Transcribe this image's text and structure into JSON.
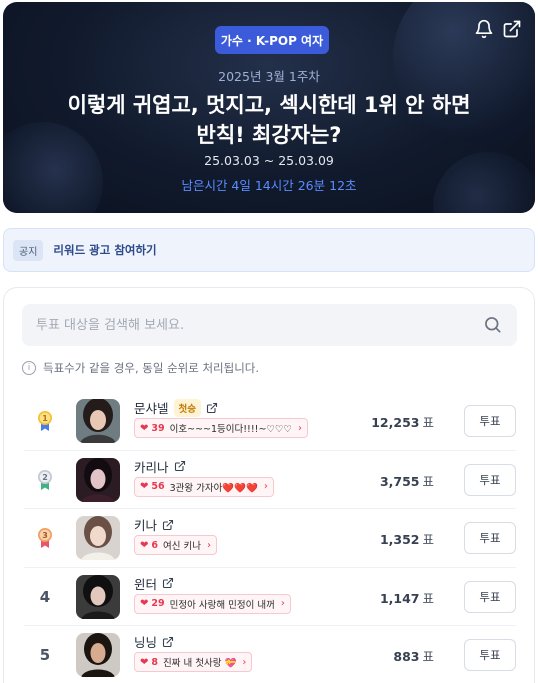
{
  "hero": {
    "category": "가수 · K-POP 여자",
    "week": "2025년 3월 1주차",
    "title_line1": "이렇게 귀엽고, 멋지고, 섹시한데 1위 안 하면",
    "title_line2": "반칙! 최강자는?",
    "dates": "25.03.03 ~ 25.03.09",
    "remaining": "남은시간 4일 14시간 26분 12초",
    "icons": [
      "bell-icon",
      "share-icon"
    ]
  },
  "notice": {
    "tag": "공지",
    "text": "리워드 광고 참여하기"
  },
  "search": {
    "placeholder": "투표 대상을 검색해 보세요."
  },
  "info_text": "득표수가 같을 경우, 동일 순위로 처리됩니다.",
  "colors": {
    "accent": "#3b5bdb",
    "remaining": "#5b8bff",
    "cheer_red": "#e63950",
    "gold": "#f5c033",
    "silver": "#c3c9d4",
    "bronze": "#f0a060"
  },
  "candidates": [
    {
      "rank": "1",
      "medal": "gold",
      "name": "문샤넬",
      "badge": "첫승",
      "cheer_count": "39",
      "cheer_text": "이호~~~1등이다!!!!~♡♡♡",
      "votes": "12,253",
      "unit": "표",
      "button": "투표"
    },
    {
      "rank": "2",
      "medal": "silver",
      "name": "카리나",
      "badge": "",
      "cheer_count": "56",
      "cheer_text": "3관왕 가자아❤️❤️❤️",
      "votes": "3,755",
      "unit": "표",
      "button": "투표"
    },
    {
      "rank": "3",
      "medal": "bronze",
      "name": "키나",
      "badge": "",
      "cheer_count": "6",
      "cheer_text": "여신 키나",
      "votes": "1,352",
      "unit": "표",
      "button": "투표"
    },
    {
      "rank": "4",
      "medal": "",
      "name": "윈터",
      "badge": "",
      "cheer_count": "29",
      "cheer_text": "민정아 사랑해 민정이 내꺼",
      "votes": "1,147",
      "unit": "표",
      "button": "투표"
    },
    {
      "rank": "5",
      "medal": "",
      "name": "닝닝",
      "badge": "",
      "cheer_count": "8",
      "cheer_text": "진짜 내 첫사랑 💝",
      "votes": "883",
      "unit": "표",
      "button": "투표"
    }
  ]
}
